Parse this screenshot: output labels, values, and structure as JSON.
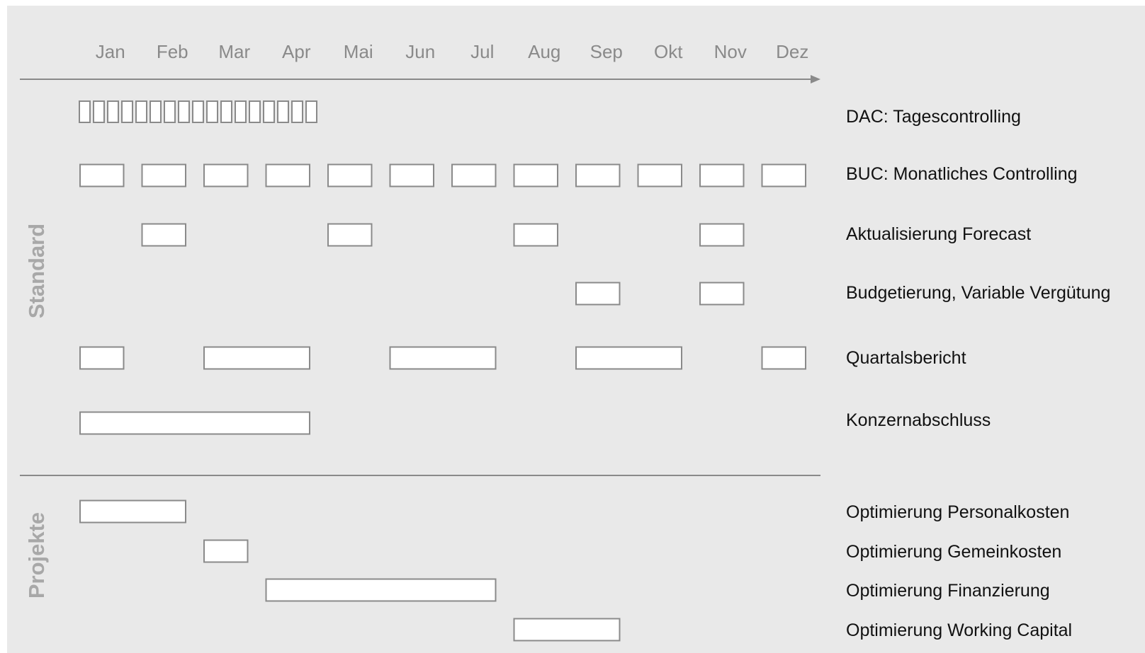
{
  "months": [
    "Jan",
    "Feb",
    "Mar",
    "Apr",
    "Mai",
    "Jun",
    "Jul",
    "Aug",
    "Sep",
    "Okt",
    "Nov",
    "Dez"
  ],
  "sections": {
    "standard": "Standard",
    "projekte": "Projekte"
  },
  "colors": {
    "background": "#e9e9e9",
    "line": "#8a8a8a",
    "box_fill": "#ffffff",
    "section_text": "#a8a8a8"
  },
  "rows": [
    {
      "key": "dac",
      "label": "DAC: Tagescontrolling",
      "section": "standard",
      "daily_marks": 17
    },
    {
      "key": "buc",
      "label": "BUC: Monatliches Controlling",
      "section": "standard",
      "bars": [
        [
          1,
          1
        ],
        [
          2,
          2
        ],
        [
          3,
          3
        ],
        [
          4,
          4
        ],
        [
          5,
          5
        ],
        [
          6,
          6
        ],
        [
          7,
          7
        ],
        [
          8,
          8
        ],
        [
          9,
          9
        ],
        [
          10,
          10
        ],
        [
          11,
          11
        ],
        [
          12,
          12
        ]
      ]
    },
    {
      "key": "forecast",
      "label": "Aktualisierung Forecast",
      "section": "standard",
      "bars": [
        [
          2,
          2
        ],
        [
          5,
          5
        ],
        [
          8,
          8
        ],
        [
          11,
          11
        ]
      ]
    },
    {
      "key": "budget",
      "label": "Budgetierung, Variable Vergütung",
      "section": "standard",
      "bars": [
        [
          9,
          9
        ],
        [
          11,
          11
        ]
      ]
    },
    {
      "key": "quartal",
      "label": "Quartalsbericht",
      "section": "standard",
      "bars": [
        [
          1,
          1
        ],
        [
          3,
          4
        ],
        [
          6,
          7
        ],
        [
          9,
          10
        ],
        [
          12,
          12
        ]
      ]
    },
    {
      "key": "konzern",
      "label": "Konzernabschluss",
      "section": "standard",
      "bars": [
        [
          1,
          4
        ]
      ]
    },
    {
      "key": "personal",
      "label": "Optimierung Personalkosten",
      "section": "projekte",
      "bars": [
        [
          1,
          2
        ]
      ]
    },
    {
      "key": "gemein",
      "label": "Optimierung Gemeinkosten",
      "section": "projekte",
      "bars": [
        [
          3,
          3
        ]
      ]
    },
    {
      "key": "finanz",
      "label": "Optimierung Finanzierung",
      "section": "projekte",
      "bars": [
        [
          4,
          7
        ]
      ]
    },
    {
      "key": "working",
      "label": "Optimierung Working Capital",
      "section": "projekte",
      "bars": [
        [
          8,
          9
        ]
      ]
    }
  ]
}
